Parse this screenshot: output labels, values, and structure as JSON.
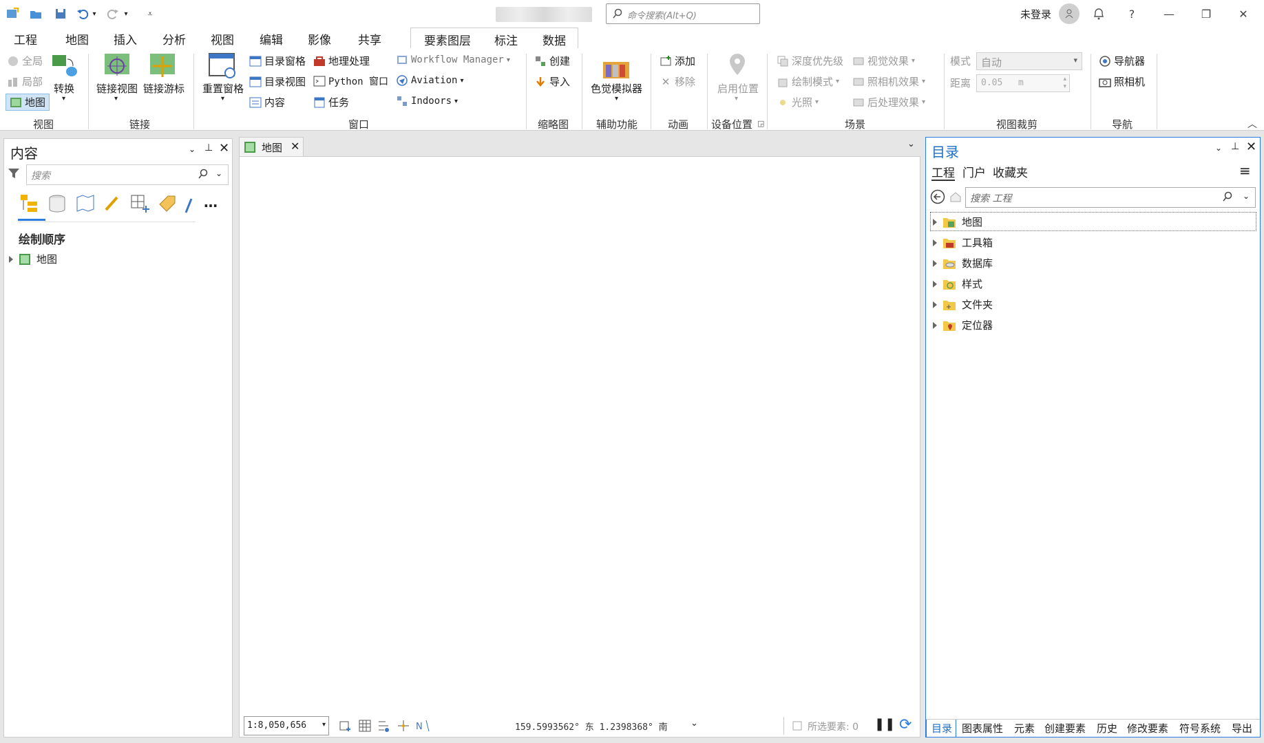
{
  "title_bar": {
    "command_search_placeholder": "命令搜索(Alt+Q)",
    "user_label": "未登录"
  },
  "ribbon_tabs": [
    "工程",
    "地图",
    "插入",
    "分析",
    "视图",
    "编辑",
    "影像",
    "共享"
  ],
  "context_tabs": [
    "要素图层",
    "标注",
    "数据"
  ],
  "ribbon": {
    "view_group": {
      "global": "全局",
      "local": "局部",
      "map": "地图",
      "convert": "转换",
      "label": "视图"
    },
    "link_group": {
      "link_view": "链接视图",
      "link_cursor": "链接游标",
      "label": "链接"
    },
    "window_group": {
      "reset_panes": "重置窗格",
      "catalog_pane": "目录窗格",
      "catalog_view": "目录视图",
      "contents": "内容",
      "geoprocessing": "地理处理",
      "python_window": "Python 窗口",
      "tasks": "任务",
      "workflow_manager": "Workflow Manager",
      "aviation": "Aviation",
      "indoors": "Indoors",
      "label": "窗口"
    },
    "overview_group": {
      "create": "创建",
      "import": "导入",
      "label": "缩略图"
    },
    "accessibility_group": {
      "color_simulator": "色觉模拟器",
      "label": "辅助功能"
    },
    "animation_group": {
      "add": "添加",
      "remove": "移除",
      "label": "动画"
    },
    "device_group": {
      "enable_location": "启用位置",
      "label": "设备位置"
    },
    "scene_group": {
      "depth_priority": "深度优先级",
      "visual_effects": "视觉效果",
      "draw_mode": "绘制模式",
      "camera_effects": "照相机效果",
      "lighting": "光照",
      "post_effects": "后处理效果",
      "label": "场景"
    },
    "clip_group": {
      "mode_label": "模式",
      "mode_value": "自动",
      "distance_label": "距离",
      "distance_value": "0.05",
      "distance_unit": "m",
      "label": "视图裁剪"
    },
    "nav_group": {
      "navigator": "导航器",
      "camera": "照相机",
      "label": "导航"
    }
  },
  "contents_pane": {
    "title": "内容",
    "search_placeholder": "搜索",
    "section": "绘制顺序",
    "items": [
      "地图"
    ]
  },
  "map_view": {
    "tab_label": "地图",
    "scale": "1:8,050,656",
    "coordinates": "159.5993562° 东 1.2398368° 南",
    "selected_features": "所选要素: 0"
  },
  "catalog_pane": {
    "title": "目录",
    "tabs": [
      "工程",
      "门户",
      "收藏夹"
    ],
    "search_placeholder": "搜索 工程",
    "items": [
      "地图",
      "工具箱",
      "数据库",
      "样式",
      "文件夹",
      "定位器"
    ],
    "bottom_tabs": [
      "目录",
      "图表属性",
      "元素",
      "创建要素",
      "历史",
      "修改要素",
      "符号系统",
      "导出"
    ]
  }
}
